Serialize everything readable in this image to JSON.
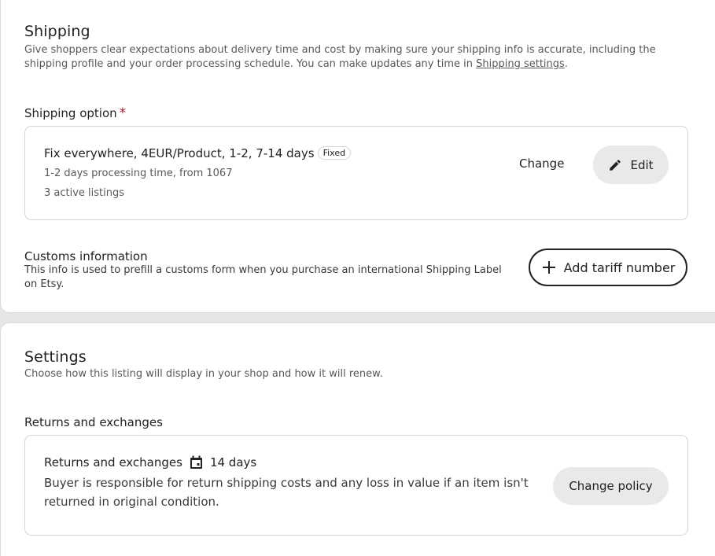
{
  "shipping": {
    "title": "Shipping",
    "description_prefix": "Give shoppers clear expectations about delivery time and cost by making sure your shipping info is accurate, including the shipping profile and your order processing schedule. You can make updates any time in ",
    "description_link": "Shipping settings",
    "description_suffix": ".",
    "option_label": "Shipping option",
    "required_marker": "*",
    "option": {
      "name": "Fix everywhere, 4EUR/Product, 1-2, 7-14 days",
      "badge": "Fixed",
      "processing": "1-2 days processing time, from 1067",
      "listings": "3 active listings",
      "change_label": "Change",
      "edit_label": "Edit"
    },
    "customs": {
      "title": "Customs information",
      "description": "This info is used to prefill a customs form when you purchase an international Shipping Label on Etsy.",
      "button_label": "Add tariff number"
    }
  },
  "settings": {
    "title": "Settings",
    "description": "Choose how this listing will display in your shop and how it will renew.",
    "returns_label": "Returns and exchanges",
    "returns": {
      "title": "Returns and exchanges",
      "days": "14 days",
      "body": "Buyer is responsible for return shipping costs and any loss in value if an item isn't returned in original condition.",
      "button_label": "Change policy"
    }
  },
  "icons": {
    "edit": "pencil-icon",
    "add": "plus-icon",
    "calendar": "calendar-icon"
  },
  "colors": {
    "required": "#a61a2e",
    "pill_bg": "#e9e9e9",
    "text": "#222222",
    "muted": "#595959"
  }
}
